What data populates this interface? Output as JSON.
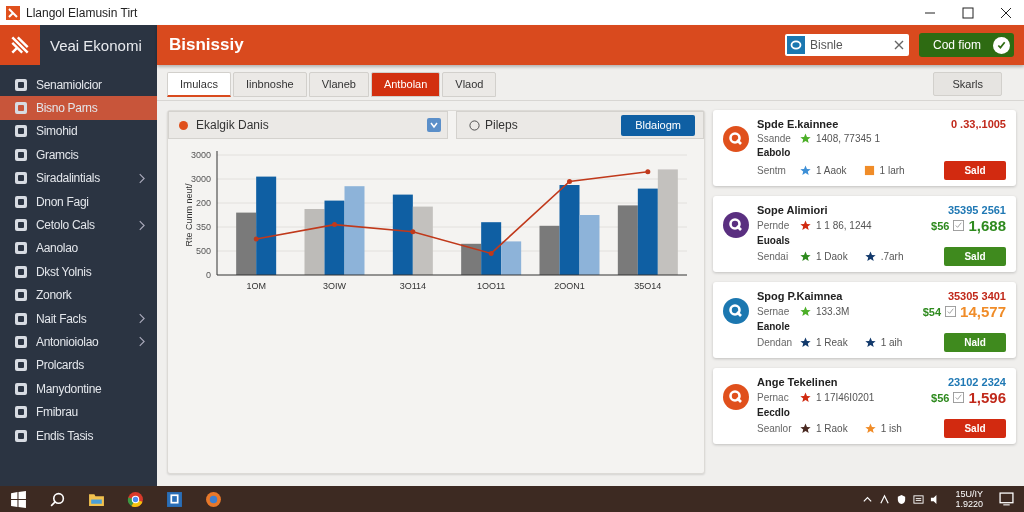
{
  "window": {
    "title": "Llangol Elamusin Tirt"
  },
  "sidebar": {
    "app_name": "Veai Ekonomi",
    "items": [
      {
        "label": "Senamiolcior",
        "selected": false,
        "submenu": false
      },
      {
        "label": "Bisno Parns",
        "selected": true,
        "submenu": false
      },
      {
        "label": "Simohid",
        "selected": false,
        "submenu": false
      },
      {
        "label": "Gramcis",
        "selected": false,
        "submenu": false
      },
      {
        "label": "Siradalintials",
        "selected": false,
        "submenu": true
      },
      {
        "label": "Dnon Fagi",
        "selected": false,
        "submenu": false
      },
      {
        "label": "Cetolo Cals",
        "selected": false,
        "submenu": true
      },
      {
        "label": "Aanolao",
        "selected": false,
        "submenu": false
      },
      {
        "label": "Dkst Yolnis",
        "selected": false,
        "submenu": false
      },
      {
        "label": "Zonork",
        "selected": false,
        "submenu": false
      },
      {
        "label": "Nait Facls",
        "selected": false,
        "submenu": true
      },
      {
        "label": "Antonioiolao",
        "selected": false,
        "submenu": true
      },
      {
        "label": "Prolcards",
        "selected": false,
        "submenu": false
      },
      {
        "label": "Manydontine",
        "selected": false,
        "submenu": false
      },
      {
        "label": "Fmibrau",
        "selected": false,
        "submenu": false
      },
      {
        "label": "Endis Tasis",
        "selected": false,
        "submenu": false
      }
    ]
  },
  "header": {
    "title": "Bisnissiy",
    "search": {
      "value": "Bisnle"
    },
    "button": "Cod fiom"
  },
  "tabs": [
    {
      "label": "Imulacs",
      "selected": true,
      "highlight": false
    },
    {
      "label": "Iinbnoshe",
      "selected": false,
      "highlight": false
    },
    {
      "label": "Vlaneb",
      "selected": false,
      "highlight": false
    },
    {
      "label": "Antbolan",
      "selected": false,
      "highlight": true
    },
    {
      "label": "Vlaod",
      "selected": false,
      "highlight": false
    }
  ],
  "toolbar_button": "Skarls",
  "chart_panel": {
    "dropdown": "Ekalgik Danis",
    "option": {
      "label": "Pileps",
      "selected": false
    },
    "button": "Bldaiogm",
    "y_axis_labels": [
      "3000",
      "3000",
      "200",
      "350",
      "500",
      "0"
    ],
    "axis_title": "Rte Cunm neut/",
    "x_axis_labels": [
      "1OM",
      "3OIW",
      "3O114",
      "1OO11",
      "2OON1",
      "35O14"
    ]
  },
  "cards": [
    {
      "avatar": {
        "color": "#e0501c"
      },
      "title": "Spde E.kainnee",
      "value": {
        "text": "0 .33,.1005",
        "color": "#c0281a"
      },
      "label": "Ssande",
      "detail": {
        "text": "1408, 77345 1",
        "icon": {
          "kind": "star",
          "color": "#4caf28"
        }
      },
      "section": "Eabolo",
      "footer_label": "Sentm",
      "tags": [
        {
          "kind": "star",
          "color": "#3d8fd6",
          "text": "1 Aaok"
        },
        {
          "kind": "square",
          "color": "#f08c28",
          "text": "1 larh"
        }
      ],
      "button": {
        "label": "Sald",
        "color": "#d22a10"
      }
    },
    {
      "avatar": {
        "color": "#5a2f80"
      },
      "title": "Sope Alimiori",
      "value": {
        "text": "35395 2561",
        "color": "#1f78b4"
      },
      "label": "Pernde",
      "detail": {
        "text": "1 1 86, 1244",
        "icon": {
          "kind": "star",
          "color": "#d02a10"
        }
      },
      "price": {
        "currency": "$56",
        "amount": "1,688",
        "color": "#2e8a1e"
      },
      "section": "Euoals",
      "footer_label": "Sendai",
      "tags": [
        {
          "kind": "star",
          "color": "#2e8a1e",
          "text": "1 Daok"
        },
        {
          "kind": "star",
          "color": "#12396b",
          "text": ".7arh"
        }
      ],
      "button": {
        "label": "Sald",
        "color": "#3f8a1e"
      }
    },
    {
      "avatar": {
        "color": "#1b77b0"
      },
      "title": "Spog P.Kaimnea",
      "value": {
        "text": "35305 3401",
        "color": "#c0281a"
      },
      "label": "Sernae",
      "detail": {
        "text": "133.3M",
        "icon": {
          "kind": "star",
          "color": "#4caf28"
        }
      },
      "price": {
        "currency": "$54",
        "amount": "14,577",
        "color": "#f08c28"
      },
      "section": "Eanole",
      "footer_label": "Dendan",
      "tags": [
        {
          "kind": "star",
          "color": "#12396b",
          "text": "1 Reak"
        },
        {
          "kind": "star",
          "color": "#12396b",
          "text": "1 aih"
        }
      ],
      "button": {
        "label": "Nald",
        "color": "#3f8a1e"
      }
    },
    {
      "avatar": {
        "color": "#e0501c"
      },
      "title": "Ange Tekelinen",
      "value": {
        "text": "23102 2324",
        "color": "#1f78b4"
      },
      "label": "Pernac",
      "detail": {
        "text": "1 17I46I0201",
        "icon": {
          "kind": "star",
          "color": "#d02a10"
        }
      },
      "price": {
        "currency": "$56",
        "amount": "1,596",
        "color": "#c0281a"
      },
      "section": "Eecdlo",
      "footer_label": "Seanlor",
      "tags": [
        {
          "kind": "star",
          "color": "#4a2a22",
          "text": "1 Raok"
        },
        {
          "kind": "star",
          "color": "#f08c28",
          "text": "1 ish"
        }
      ],
      "button": {
        "label": "Sald",
        "color": "#d22a10"
      }
    }
  ],
  "taskbar": {
    "date": "15U/IY",
    "time": "1.9220"
  }
}
